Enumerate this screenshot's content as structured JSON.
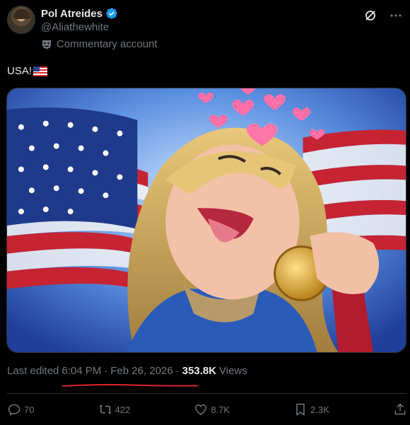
{
  "post": {
    "author": {
      "display_name": "Pol Atreides",
      "handle": "@Aliathewhite",
      "verified": true,
      "account_label": "Commentary account"
    },
    "text": "USA!",
    "text_emoji": "us-flag-emoji",
    "meta": {
      "prefix": "Last edited",
      "time": "6:04 PM",
      "separator": "·",
      "date": "Feb 26, 2026",
      "separator2": "·",
      "views_count": "353.8K",
      "views_label": "Views"
    },
    "actions": {
      "replies": "70",
      "reposts": "422",
      "likes": "8.7K",
      "bookmarks": "2.3K"
    }
  },
  "colors": {
    "background": "#000000",
    "primary_text": "#e7e9ea",
    "secondary_text": "#71767b",
    "verified_blue": "#1d9bf0",
    "divider": "#2f3336",
    "annotation_red": "#e0242a"
  },
  "icons": {
    "verified": "verified-badge-icon",
    "commentary": "theater-mask-icon",
    "grok": "grok-icon",
    "more": "more-icon",
    "reply": "reply-icon",
    "repost": "repost-icon",
    "like": "heart-icon",
    "bookmark": "bookmark-icon",
    "share": "share-icon"
  }
}
